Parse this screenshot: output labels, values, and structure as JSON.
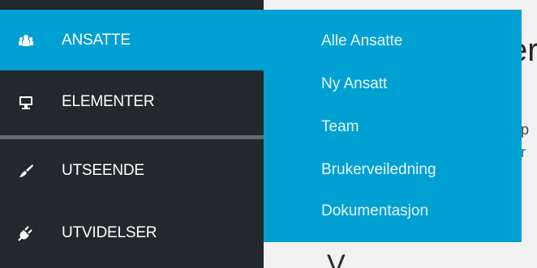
{
  "menu": {
    "items": [
      {
        "label": "ANSATTE",
        "icon": "users-group-icon",
        "active": true
      },
      {
        "label": "ELEMENTER",
        "icon": "monitor-icon",
        "active": false
      },
      {
        "label": "UTSEENDE",
        "icon": "paintbrush-icon",
        "active": false
      },
      {
        "label": "UTVIDELSER",
        "icon": "plugin-icon",
        "active": false
      }
    ]
  },
  "submenu": {
    "items": [
      {
        "label": "Alle Ansatte"
      },
      {
        "label": "Ny Ansatt"
      },
      {
        "label": "Team"
      },
      {
        "label": "Brukerveiledning"
      },
      {
        "label": "Dokumentasjon"
      }
    ]
  },
  "content": {
    "heading_fragment": "er",
    "line_fragment_1": "up",
    "line_fragment_2": "ar",
    "bottom_heading_fragment": "V"
  },
  "colors": {
    "sidebar_bg": "#23282d",
    "active_bg": "#00a0d2",
    "separator": "#656a70",
    "content_bg": "#f1f1f1",
    "link": "#0073aa"
  }
}
